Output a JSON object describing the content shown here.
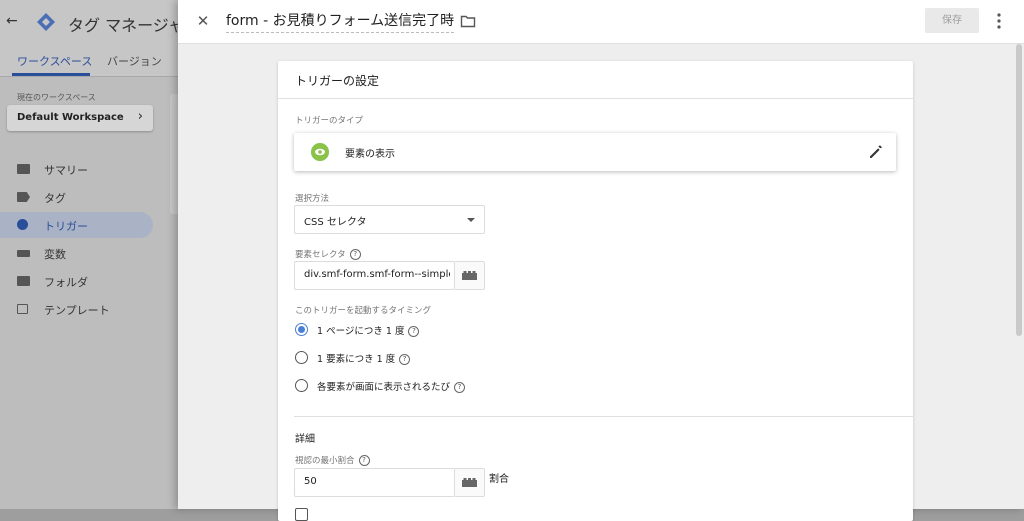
{
  "background": {
    "app_title": "タグ マネージャ",
    "tabs": [
      {
        "label": "ワークスペース",
        "active": true
      },
      {
        "label": "バージョン",
        "active": false
      }
    ],
    "workspace_label": "現在のワークスペース",
    "workspace_name": "Default Workspace",
    "nav": [
      {
        "label": "サマリー",
        "icon": "briefcase-icon"
      },
      {
        "label": "タグ",
        "icon": "tag-icon"
      },
      {
        "label": "トリガー",
        "icon": "trigger-icon",
        "active": true
      },
      {
        "label": "変数",
        "icon": "variables-icon"
      },
      {
        "label": "フォルダ",
        "icon": "folder-icon"
      },
      {
        "label": "テンプレート",
        "icon": "template-icon"
      }
    ]
  },
  "header": {
    "trigger_name": "form - お見積りフォーム送信完了時",
    "save_label": "保存"
  },
  "card": {
    "title": "トリガーの設定",
    "trigger_type_label": "トリガーのタイプ",
    "trigger_type_value": "要素の表示",
    "selection_method_label": "選択方法",
    "selection_method_value": "CSS セレクタ",
    "element_selector_label": "要素セレクタ",
    "element_selector_value": "div.smf-form.smf-form--simple-ta",
    "timing_label": "このトリガーを起動するタイミング",
    "timing_options": [
      {
        "label": "1 ページにつき 1 度",
        "checked": true
      },
      {
        "label": "1 要素につき 1 度",
        "checked": false
      },
      {
        "label": "各要素が画面に表示されるたび",
        "checked": false
      }
    ],
    "details_title": "詳細",
    "min_visible_label": "視認の最小割合",
    "min_visible_value": "50",
    "min_visible_unit": "割合"
  },
  "colors": {
    "accent": "#4a7fd6",
    "trigger_icon": "#8bc34a"
  }
}
